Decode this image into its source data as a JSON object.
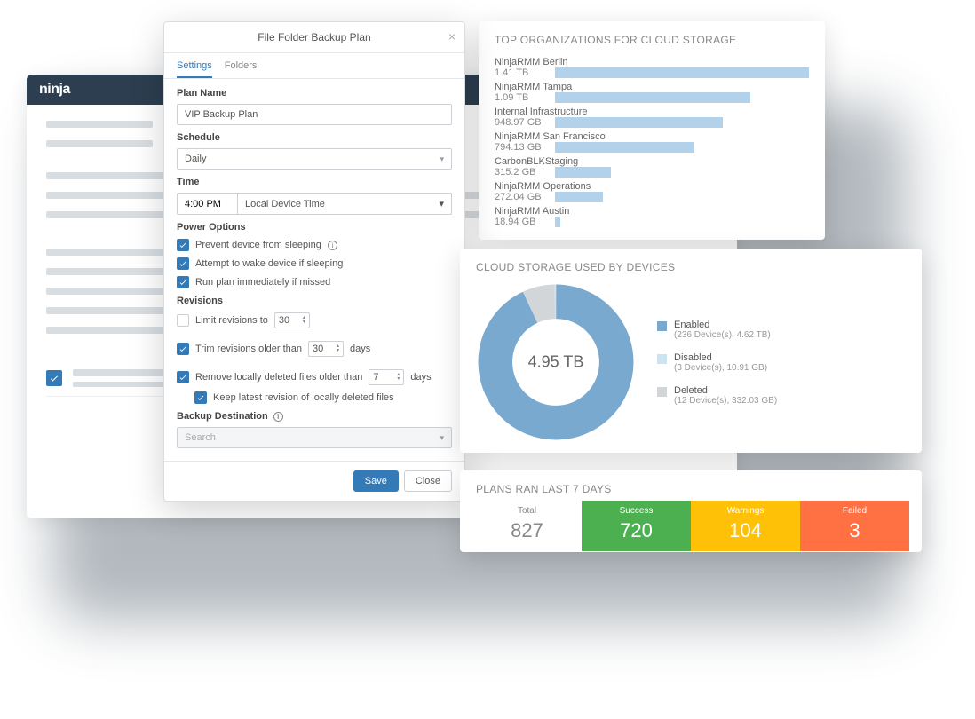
{
  "brand": "ninja",
  "modal": {
    "title": "File Folder Backup Plan",
    "tabs": [
      "Settings",
      "Folders"
    ],
    "plan_name_label": "Plan Name",
    "plan_name": "VIP Backup Plan",
    "schedule_label": "Schedule",
    "schedule": "Daily",
    "time_label": "Time",
    "time": "4:00 PM",
    "tz": "Local Device Time",
    "power_label": "Power Options",
    "power": {
      "prevent": "Prevent device from sleeping",
      "wake": "Attempt to wake device if sleeping",
      "run_missed": "Run plan immediately if missed"
    },
    "revisions_label": "Revisions",
    "limit_label": "Limit revisions to",
    "limit_value": "30",
    "trim_label": "Trim revisions older than",
    "trim_value": "30",
    "days": "days",
    "remove_local_label": "Remove locally deleted files older than",
    "remove_local_value": "7",
    "keep_latest": "Keep latest revision of locally deleted files",
    "dest_label": "Backup Destination",
    "dest_placeholder": "Search",
    "save": "Save",
    "close": "Close"
  },
  "orgs": {
    "title": "TOP ORGANIZATIONS FOR CLOUD STORAGE",
    "items": [
      {
        "name": "NinjaRMM Berlin",
        "size": "1.41 TB",
        "pct": 100
      },
      {
        "name": "NinjaRMM Tampa",
        "size": "1.09 TB",
        "pct": 77
      },
      {
        "name": "Internal Infrastructure",
        "size": "948.97 GB",
        "pct": 66
      },
      {
        "name": "NinjaRMM San Francisco",
        "size": "794.13 GB",
        "pct": 55
      },
      {
        "name": "CarbonBLKStaging",
        "size": "315.2 GB",
        "pct": 22
      },
      {
        "name": "NinjaRMM Operations",
        "size": "272.04 GB",
        "pct": 19
      },
      {
        "name": "NinjaRMM Austin",
        "size": "18.94 GB",
        "pct": 2
      }
    ]
  },
  "donut": {
    "title": "CLOUD STORAGE USED BY DEVICES",
    "center": "4.95 TB",
    "legend": [
      {
        "label": "Enabled",
        "sub": "(236 Device(s), 4.62 TB)",
        "color": "#7aa9cf"
      },
      {
        "label": "Disabled",
        "sub": "(3 Device(s), 10.91 GB)",
        "color": "#cce3f2"
      },
      {
        "label": "Deleted",
        "sub": "(12 Device(s), 332.03 GB)",
        "color": "#d3d6d9"
      }
    ]
  },
  "chart_data": {
    "type": "pie",
    "title": "Cloud Storage Used By Devices",
    "total_label": "4.95 TB",
    "series": [
      {
        "name": "Enabled",
        "devices": 236,
        "storage_tb": 4.62
      },
      {
        "name": "Disabled",
        "devices": 3,
        "storage_gb": 10.91
      },
      {
        "name": "Deleted",
        "devices": 12,
        "storage_gb": 332.03
      }
    ]
  },
  "plans": {
    "title": "PLANS RAN LAST 7 DAYS",
    "total_label": "Total",
    "total": "827",
    "success_label": "Success",
    "success": "720",
    "warn_label": "Warnings",
    "warn": "104",
    "fail_label": "Failed",
    "fail": "3"
  }
}
